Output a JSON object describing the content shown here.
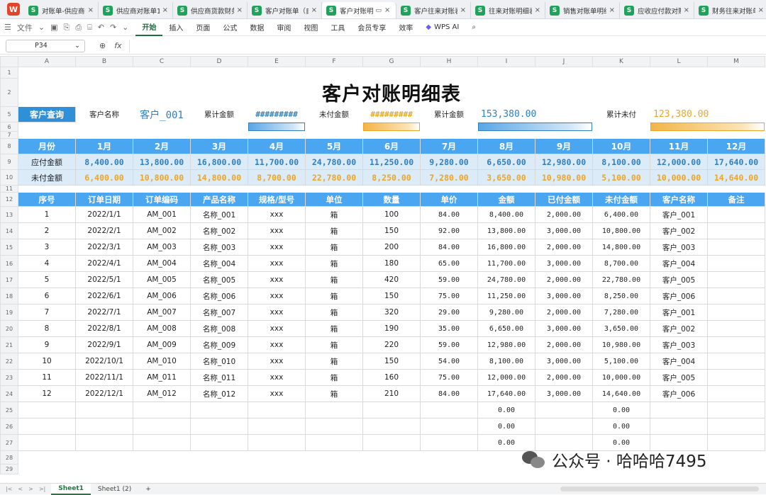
{
  "tabs": [
    {
      "label": "对账单-供应商往来"
    },
    {
      "label": "供应商对账单1.xlsx"
    },
    {
      "label": "供应商货款财务对账"
    },
    {
      "label": "客户对账单（自动"
    },
    {
      "label": "客户对账明"
    },
    {
      "label": "客户往来对账表"
    },
    {
      "label": "往来对账明细表"
    },
    {
      "label": "销售对账单明细1"
    },
    {
      "label": "应收应付款对账单"
    },
    {
      "label": "财务往来对账单1."
    }
  ],
  "menu": {
    "file_label": "文件",
    "items": [
      "开始",
      "插入",
      "页面",
      "公式",
      "数据",
      "审阅",
      "视图",
      "工具",
      "会员专享",
      "效率"
    ],
    "wps_ai": "WPS AI"
  },
  "formula_bar": {
    "cell_ref": "P34",
    "fx": "fx"
  },
  "columns": [
    "A",
    "B",
    "C",
    "D",
    "E",
    "F",
    "G",
    "H",
    "I",
    "J",
    "K",
    "L",
    "M"
  ],
  "row_numbers": [
    "1",
    "2",
    "3",
    "4",
    "5",
    "6",
    "7",
    "8",
    "9",
    "10",
    "11",
    "12",
    "13",
    "14",
    "15",
    "16",
    "17",
    "18",
    "19",
    "20",
    "21",
    "22",
    "23",
    "24",
    "25",
    "26",
    "27",
    "28",
    "29"
  ],
  "sheet": {
    "title": "客户对账明细表",
    "query_button": "客户查询",
    "customer_name_label": "客户名称",
    "customer_name_value": "客户_001",
    "cum_amount_label": "累计金额",
    "cum_amount_hash": "#########",
    "unpaid_label": "未付金额",
    "unpaid_hash": "#########",
    "cum_amount_label2": "累计金额",
    "cum_amount_value": "153,380.00",
    "cum_unpaid_label": "累计未付",
    "cum_unpaid_value": "123,380.00"
  },
  "monthly": {
    "header_label": "月份",
    "months": [
      "1月",
      "2月",
      "3月",
      "4月",
      "5月",
      "6月",
      "7月",
      "8月",
      "9月",
      "10月",
      "11月",
      "12月"
    ],
    "receivable_label": "应付金额",
    "receivable": [
      "8,400.00",
      "13,800.00",
      "16,800.00",
      "11,700.00",
      "24,780.00",
      "11,250.00",
      "9,280.00",
      "6,650.00",
      "12,980.00",
      "8,100.00",
      "12,000.00",
      "17,640.00"
    ],
    "unpaid_label": "未付金额",
    "unpaid": [
      "6,400.00",
      "10,800.00",
      "14,800.00",
      "8,700.00",
      "22,780.00",
      "8,250.00",
      "7,280.00",
      "3,650.00",
      "10,980.00",
      "5,100.00",
      "10,000.00",
      "14,640.00"
    ]
  },
  "detail": {
    "headers": [
      "序号",
      "订单日期",
      "订单编码",
      "产品名称",
      "规格/型号",
      "单位",
      "数量",
      "单价",
      "金额",
      "已付金额",
      "未付金额",
      "客户名称",
      "备注"
    ],
    "rows": [
      [
        "1",
        "2022/1/1",
        "AM_001",
        "名称_001",
        "xxx",
        "箱",
        "100",
        "84.00",
        "8,400.00",
        "2,000.00",
        "6,400.00",
        "客户_001",
        ""
      ],
      [
        "2",
        "2022/2/1",
        "AM_002",
        "名称_002",
        "xxx",
        "箱",
        "150",
        "92.00",
        "13,800.00",
        "3,000.00",
        "10,800.00",
        "客户_002",
        ""
      ],
      [
        "3",
        "2022/3/1",
        "AM_003",
        "名称_003",
        "xxx",
        "箱",
        "200",
        "84.00",
        "16,800.00",
        "2,000.00",
        "14,800.00",
        "客户_003",
        ""
      ],
      [
        "4",
        "2022/4/1",
        "AM_004",
        "名称_004",
        "xxx",
        "箱",
        "180",
        "65.00",
        "11,700.00",
        "3,000.00",
        "8,700.00",
        "客户_004",
        ""
      ],
      [
        "5",
        "2022/5/1",
        "AM_005",
        "名称_005",
        "xxx",
        "箱",
        "420",
        "59.00",
        "24,780.00",
        "2,000.00",
        "22,780.00",
        "客户_005",
        ""
      ],
      [
        "6",
        "2022/6/1",
        "AM_006",
        "名称_006",
        "xxx",
        "箱",
        "150",
        "75.00",
        "11,250.00",
        "3,000.00",
        "8,250.00",
        "客户_006",
        ""
      ],
      [
        "7",
        "2022/7/1",
        "AM_007",
        "名称_007",
        "xxx",
        "箱",
        "320",
        "29.00",
        "9,280.00",
        "2,000.00",
        "7,280.00",
        "客户_001",
        ""
      ],
      [
        "8",
        "2022/8/1",
        "AM_008",
        "名称_008",
        "xxx",
        "箱",
        "190",
        "35.00",
        "6,650.00",
        "3,000.00",
        "3,650.00",
        "客户_002",
        ""
      ],
      [
        "9",
        "2022/9/1",
        "AM_009",
        "名称_009",
        "xxx",
        "箱",
        "220",
        "59.00",
        "12,980.00",
        "2,000.00",
        "10,980.00",
        "客户_003",
        ""
      ],
      [
        "10",
        "2022/10/1",
        "AM_010",
        "名称_010",
        "xxx",
        "箱",
        "150",
        "54.00",
        "8,100.00",
        "3,000.00",
        "5,100.00",
        "客户_004",
        ""
      ],
      [
        "11",
        "2022/11/1",
        "AM_011",
        "名称_011",
        "xxx",
        "箱",
        "160",
        "75.00",
        "12,000.00",
        "2,000.00",
        "10,000.00",
        "客户_005",
        ""
      ],
      [
        "12",
        "2022/12/1",
        "AM_012",
        "名称_012",
        "xxx",
        "箱",
        "210",
        "84.00",
        "17,640.00",
        "3,000.00",
        "14,640.00",
        "客户_006",
        ""
      ],
      [
        "",
        "",
        "",
        "",
        "",
        "",
        "",
        "",
        "0.00",
        "",
        "0.00",
        "",
        ""
      ],
      [
        "",
        "",
        "",
        "",
        "",
        "",
        "",
        "",
        "0.00",
        "",
        "0.00",
        "",
        ""
      ],
      [
        "",
        "",
        "",
        "",
        "",
        "",
        "",
        "",
        "0.00",
        "",
        "0.00",
        "",
        ""
      ]
    ]
  },
  "statusbar": {
    "sheets": [
      "Sheet1",
      "Sheet1 (2)"
    ],
    "add": "+"
  },
  "watermark": "公众号 · 哈哈哈7495",
  "colors": {
    "header_blue": "#4aa6f0",
    "light_blue": "#dcebf8",
    "value_blue": "#2f7fc1",
    "value_orange": "#f0a520",
    "query_button": "#2f8fd7",
    "active_green": "#1b6e3f"
  }
}
